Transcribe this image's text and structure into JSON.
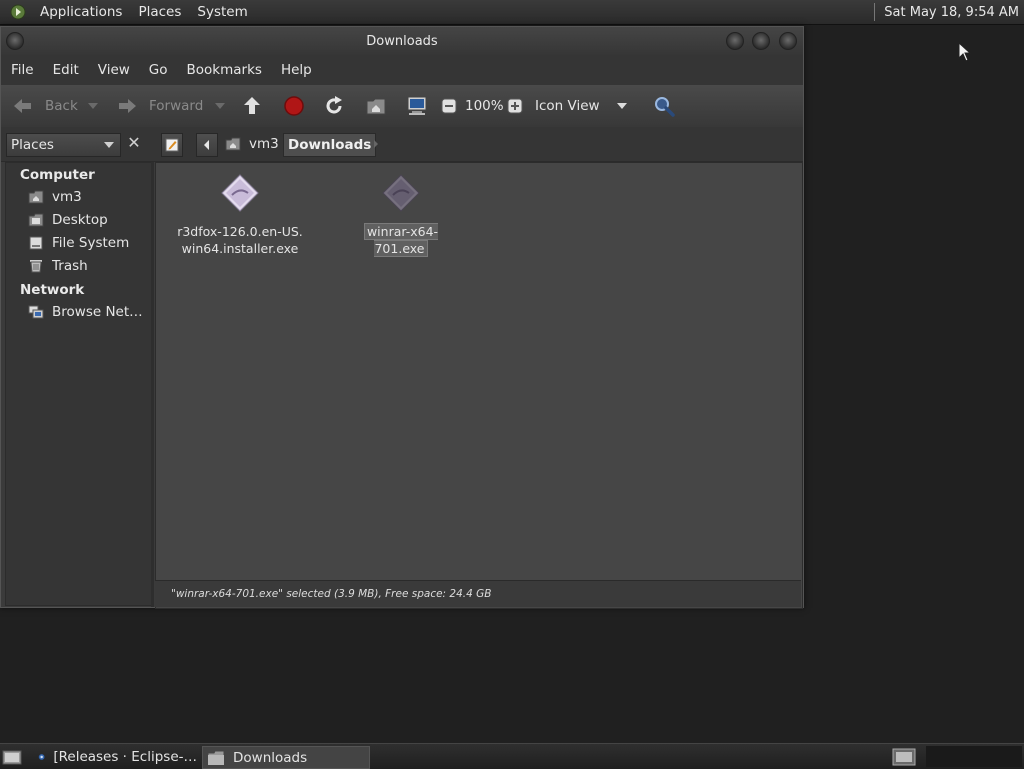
{
  "top_panel": {
    "menu": [
      "Applications",
      "Places",
      "System"
    ],
    "clock": "Sat May 18,  9:54 AM"
  },
  "window": {
    "title": "Downloads",
    "menu": [
      "File",
      "Edit",
      "View",
      "Go",
      "Bookmarks",
      "Help"
    ],
    "toolbar": {
      "back": "Back",
      "forward": "Forward",
      "zoom": "100%",
      "view_mode": "Icon View"
    },
    "location": {
      "places_label": "Places",
      "crumbs": [
        "vm3",
        "Downloads"
      ]
    },
    "sidebar": {
      "computer_header": "Computer",
      "computer_items": [
        "vm3",
        "Desktop",
        "File System",
        "Trash"
      ],
      "network_header": "Network",
      "network_items": [
        "Browse Net…"
      ]
    },
    "files": [
      {
        "line1": "r3dfox-126.0.en-US.",
        "line2": "win64.installer.exe",
        "selected": false
      },
      {
        "line1": "winrar-x64-701.exe",
        "line2": "",
        "selected": true
      }
    ],
    "status": "\"winrar-x64-701.exe\" selected (3.9 MB), Free space: 24.4 GB"
  },
  "taskbar": {
    "tasks": [
      "[Releases · Eclipse-…",
      "Downloads"
    ]
  },
  "colors": {
    "panel": "#2f2f2f",
    "window_bg": "#3b3b3b",
    "content_bg": "#464646",
    "stop_red": "#b01616"
  }
}
